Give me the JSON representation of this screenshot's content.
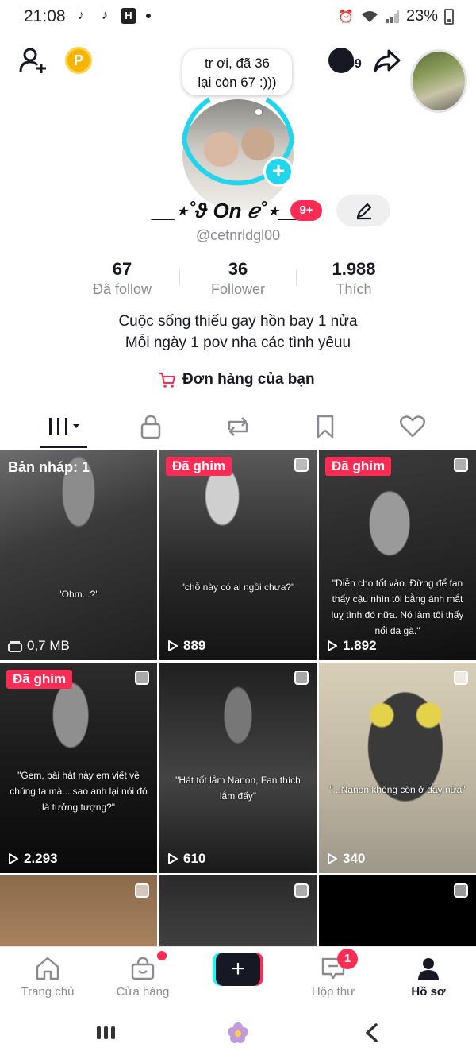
{
  "status_bar": {
    "time": "21:08",
    "app_icons": [
      "tiktok-icon",
      "tiktok-icon",
      "h-app-icon"
    ],
    "battery": "23%"
  },
  "header": {
    "coin_label": "P",
    "progress_count": "99"
  },
  "profile": {
    "note": [
      "tr ơi, đã 36",
      "lại còn 67 :)))"
    ],
    "display_name": "__⋆˚ϑ On ℯ˚⋆__",
    "notification_badge": "9+",
    "username": "@cetnrldgl00"
  },
  "stats": [
    {
      "value": "67",
      "label": "Đã follow"
    },
    {
      "value": "36",
      "label": "Follower"
    },
    {
      "value": "1.988",
      "label": "Thích"
    }
  ],
  "bio": [
    "Cuộc sống thiếu gay hồn bay 1 nửa",
    "Mỗi ngày 1 pov nha các tình yêuu"
  ],
  "orders_label": "Đơn hàng của bạn",
  "tabs": [
    "videos",
    "private",
    "reposts",
    "favorites",
    "liked"
  ],
  "grid": [
    {
      "badge": "",
      "draft": "Bản nháp: 1",
      "caption": "\"Ohm...?\"",
      "stat": "0,7 MB"
    },
    {
      "badge": "Đã ghim",
      "draft": "",
      "caption": "\"chỗ này có ai ngồi chưa?\"",
      "stat": "889"
    },
    {
      "badge": "Đã ghim",
      "draft": "",
      "caption": "\"Diễn cho tốt vào. Đừng để fan thấy cậu nhìn tôi bằng ánh mắt luỵ tình đó nữa. Nó làm tôi thấy nổi da gà.\"",
      "stat": "1.892"
    },
    {
      "badge": "Đã ghim",
      "draft": "",
      "caption": "\"Gem, bài hát này em viết về chúng ta mà... sao anh lại nói đó là tưởng tượng?\"",
      "stat": "2.293"
    },
    {
      "badge": "",
      "draft": "",
      "caption": "\"Hát tốt lắm Nanon, Fan thích lắm đấy\"",
      "stat": "610"
    },
    {
      "badge": "",
      "draft": "",
      "caption": "\"...Nanon không còn ở đây nữa\"",
      "stat": "340"
    },
    {
      "badge": "",
      "draft": "",
      "caption": "",
      "stat": ""
    },
    {
      "badge": "",
      "draft": "",
      "caption": "",
      "stat": ""
    },
    {
      "badge": "",
      "draft": "",
      "caption": "",
      "stat": ""
    }
  ],
  "bottom_nav": [
    {
      "label": "Trang chủ"
    },
    {
      "label": "Cửa hàng"
    },
    {
      "label": ""
    },
    {
      "label": "Hộp thư"
    },
    {
      "label": "Hồ sơ"
    }
  ],
  "inbox_badge": "1",
  "colors": {
    "accent": "#fe2c55",
    "cyan": "#25f4ee",
    "text": "#161823",
    "secondary": "#8a8b91"
  }
}
